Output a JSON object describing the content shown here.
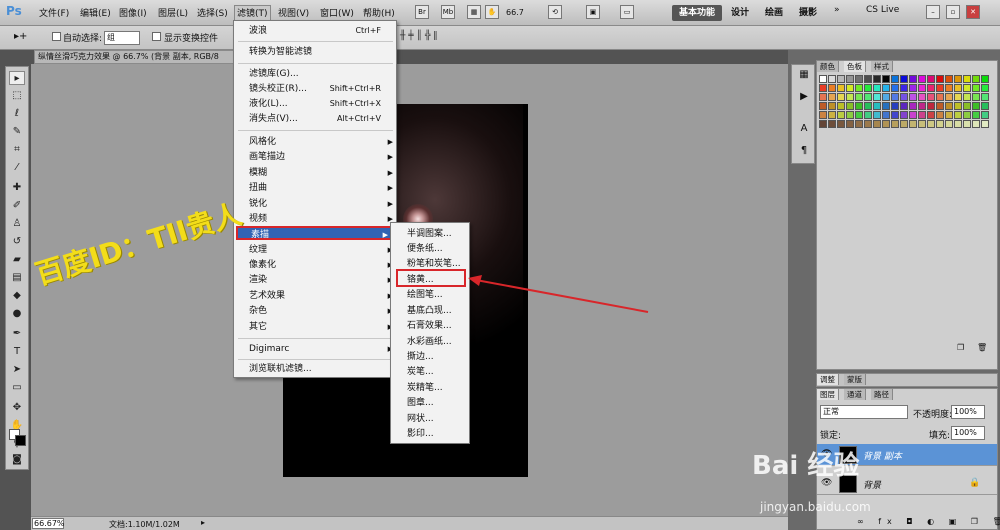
{
  "menubar": {
    "logo": "Ps",
    "items": [
      "文件(F)",
      "编辑(E)",
      "图像(I)",
      "图层(L)",
      "选择(S)",
      "滤镜(T)",
      "视图(V)",
      "窗口(W)",
      "帮助(H)"
    ],
    "zoom": "66.7",
    "workspaces": [
      "基本功能",
      "设计",
      "绘画",
      "摄影"
    ],
    "cslive": "CS Live"
  },
  "options": {
    "auto_select_label": "自动选择:",
    "auto_select_value": "组",
    "show_transform_label": "显示变换控件"
  },
  "document": {
    "tab_title": "纵情丝滑巧克力效果 @ 66.7% (背景 副本, RGB/8"
  },
  "filter_menu": {
    "items": [
      {
        "label": "波浪",
        "shortcut": "Ctrl+F"
      },
      {
        "label": "转换为智能滤镜",
        "shortcut": ""
      },
      {
        "label": "滤镜库(G)...",
        "shortcut": ""
      },
      {
        "label": "镜头校正(R)...",
        "shortcut": "Shift+Ctrl+R"
      },
      {
        "label": "液化(L)...",
        "shortcut": "Shift+Ctrl+X"
      },
      {
        "label": "消失点(V)...",
        "shortcut": "Alt+Ctrl+V"
      },
      {
        "label": "风格化",
        "shortcut": ""
      },
      {
        "label": "画笔描边",
        "shortcut": ""
      },
      {
        "label": "模糊",
        "shortcut": ""
      },
      {
        "label": "扭曲",
        "shortcut": ""
      },
      {
        "label": "锐化",
        "shortcut": ""
      },
      {
        "label": "视频",
        "shortcut": ""
      },
      {
        "label": "素描",
        "shortcut": ""
      },
      {
        "label": "纹理",
        "shortcut": ""
      },
      {
        "label": "像素化",
        "shortcut": ""
      },
      {
        "label": "渲染",
        "shortcut": ""
      },
      {
        "label": "艺术效果",
        "shortcut": ""
      },
      {
        "label": "杂色",
        "shortcut": ""
      },
      {
        "label": "其它",
        "shortcut": ""
      },
      {
        "label": "Digimarc",
        "shortcut": ""
      },
      {
        "label": "浏览联机滤镜...",
        "shortcut": ""
      }
    ]
  },
  "sketch_submenu": {
    "items": [
      "半调图案...",
      "便条纸...",
      "粉笔和炭笔...",
      "铬黄...",
      "绘图笔...",
      "基底凸现...",
      "石膏效果...",
      "水彩画纸...",
      "撕边...",
      "炭笔...",
      "炭精笔...",
      "图章...",
      "网状...",
      "影印..."
    ]
  },
  "watermark": "百度ID：TII贵人",
  "statusbar": {
    "zoom": "66.67%",
    "doc": "文档:1.10M/1.02M"
  },
  "panels": {
    "color_tabs": [
      "颜色",
      "色板",
      "样式"
    ],
    "adj_tabs": [
      "调整",
      "蒙版"
    ],
    "layer_tabs": [
      "图层",
      "通道",
      "路径"
    ],
    "blend_mode": "正常",
    "opacity_label": "不透明度:",
    "opacity": "100%",
    "lock_label": "锁定:",
    "fill_label": "填充:",
    "fill": "100%",
    "layers": [
      "背景 副本",
      "背景"
    ]
  },
  "baidu_logo": "Bai 经验",
  "baidu_url": "jingyan.baidu.com"
}
